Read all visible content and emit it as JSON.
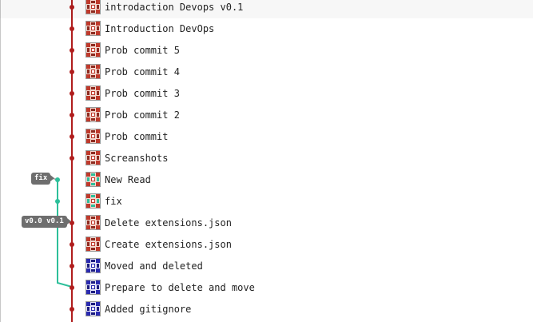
{
  "colors": {
    "main_branch": "#b01d1d",
    "fix_branch": "#2dbf9a",
    "tag_bg": "#6e6e6e"
  },
  "tags": {
    "fix_label": "fix",
    "version_label": "v0.0 v0.1"
  },
  "commits": [
    {
      "message": "introdaction Devops v0.1",
      "avatar": "avatar-red-icon"
    },
    {
      "message": "Introduction DevOps",
      "avatar": "avatar-red-icon"
    },
    {
      "message": "Prob commit 5",
      "avatar": "avatar-red-icon"
    },
    {
      "message": "Prob commit 4",
      "avatar": "avatar-red-icon"
    },
    {
      "message": "Prob commit 3",
      "avatar": "avatar-red-icon"
    },
    {
      "message": "Prob commit 2",
      "avatar": "avatar-red-icon"
    },
    {
      "message": "Prob commit",
      "avatar": "avatar-red-icon"
    },
    {
      "message": "Screanshots",
      "avatar": "avatar-red-icon"
    },
    {
      "message": "New Read",
      "avatar": "avatar-teal-icon"
    },
    {
      "message": "fix",
      "avatar": "avatar-teal-icon"
    },
    {
      "message": "Delete extensions.json",
      "avatar": "avatar-red-icon"
    },
    {
      "message": "Create extensions.json",
      "avatar": "avatar-red-icon"
    },
    {
      "message": "Moved and deleted",
      "avatar": "avatar-blue-icon"
    },
    {
      "message": "Prepare to delete and move",
      "avatar": "avatar-blue-icon"
    },
    {
      "message": "Added gitignore",
      "avatar": "avatar-blue-icon"
    }
  ]
}
